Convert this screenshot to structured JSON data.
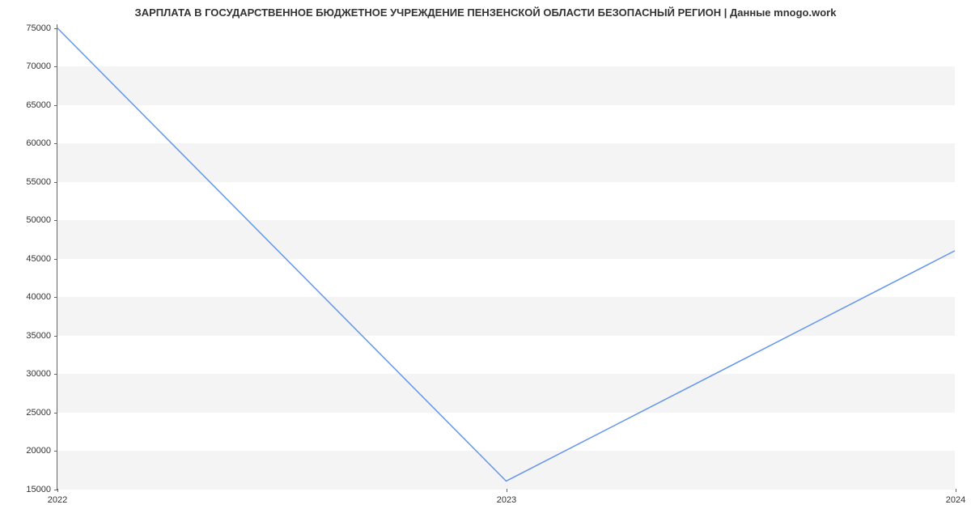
{
  "chart_data": {
    "type": "line",
    "title": "ЗАРПЛАТА В ГОСУДАРСТВЕННОЕ БЮДЖЕТНОЕ УЧРЕЖДЕНИЕ ПЕНЗЕНСКОЙ ОБЛАСТИ БЕЗОПАСНЫЙ РЕГИОН | Данные mnogo.work",
    "xlabel": "",
    "ylabel": "",
    "x": [
      "2022",
      "2023",
      "2024"
    ],
    "values": [
      75000,
      16000,
      46000
    ],
    "y_ticks": [
      15000,
      20000,
      25000,
      30000,
      35000,
      40000,
      45000,
      50000,
      55000,
      60000,
      65000,
      70000,
      75000
    ],
    "x_ticks": [
      "2022",
      "2023",
      "2024"
    ],
    "ylim": [
      15000,
      75500
    ],
    "xlim": [
      2022,
      2024
    ],
    "line_color": "#6495ed"
  }
}
